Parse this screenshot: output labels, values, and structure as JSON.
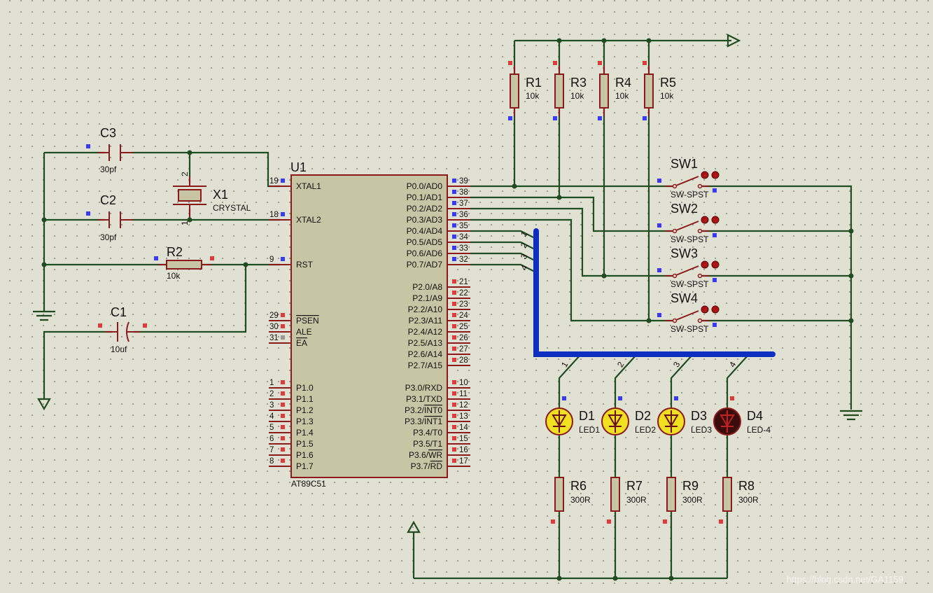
{
  "colors": {
    "background": "#e1e1d3",
    "wire": "#1f4d1f",
    "component": "#8b1a1a",
    "chip_fill": "#c8c5a4",
    "bus": "#0d2fbf",
    "led_on": "#f0e020",
    "led_off": "#3a0c0c",
    "pin_high": "#e23b3b",
    "pin_low": "#3b3bff"
  },
  "mcu": {
    "ref": "U1",
    "part": "AT89C51",
    "left_pins": [
      {
        "num": "19",
        "name": "XTAL1"
      },
      {
        "num": "18",
        "name": "XTAL2"
      },
      {
        "num": "9",
        "name": "RST"
      },
      {
        "num": "29",
        "name": "PSEN"
      },
      {
        "num": "30",
        "name": "ALE"
      },
      {
        "num": "31",
        "name": "EA"
      },
      {
        "num": "1",
        "name": "P1.0"
      },
      {
        "num": "2",
        "name": "P1.1"
      },
      {
        "num": "3",
        "name": "P1.2"
      },
      {
        "num": "4",
        "name": "P1.3"
      },
      {
        "num": "5",
        "name": "P1.4"
      },
      {
        "num": "6",
        "name": "P1.5"
      },
      {
        "num": "7",
        "name": "P1.6"
      },
      {
        "num": "8",
        "name": "P1.7"
      }
    ],
    "right_pins": [
      {
        "num": "39",
        "name": "P0.0/AD0"
      },
      {
        "num": "38",
        "name": "P0.1/AD1"
      },
      {
        "num": "37",
        "name": "P0.2/AD2"
      },
      {
        "num": "36",
        "name": "P0.3/AD3"
      },
      {
        "num": "35",
        "name": "P0.4/AD4"
      },
      {
        "num": "34",
        "name": "P0.5/AD5"
      },
      {
        "num": "33",
        "name": "P0.6/AD6"
      },
      {
        "num": "32",
        "name": "P0.7/AD7"
      },
      {
        "num": "21",
        "name": "P2.0/A8"
      },
      {
        "num": "22",
        "name": "P2.1/A9"
      },
      {
        "num": "23",
        "name": "P2.2/A10"
      },
      {
        "num": "24",
        "name": "P2.3/A11"
      },
      {
        "num": "25",
        "name": "P2.4/A12"
      },
      {
        "num": "26",
        "name": "P2.5/A13"
      },
      {
        "num": "27",
        "name": "P2.6/A14"
      },
      {
        "num": "28",
        "name": "P2.7/A15"
      },
      {
        "num": "10",
        "name": "P3.0/RXD"
      },
      {
        "num": "11",
        "name": "P3.1/TXD"
      },
      {
        "num": "12",
        "name": "P3.2/INT0"
      },
      {
        "num": "13",
        "name": "P3.3/INT1"
      },
      {
        "num": "14",
        "name": "P3.4/T0"
      },
      {
        "num": "15",
        "name": "P3.5/T1"
      },
      {
        "num": "16",
        "name": "P3.6/WR"
      },
      {
        "num": "17",
        "name": "P3.7/RD"
      }
    ]
  },
  "caps": [
    {
      "ref": "C3",
      "value": "30pf"
    },
    {
      "ref": "C2",
      "value": "30pf"
    },
    {
      "ref": "C1",
      "value": "10uf"
    }
  ],
  "crystal": {
    "ref": "X1",
    "value": "CRYSTAL",
    "pin_top": "2",
    "pin_bottom": "1"
  },
  "reset_resistor": {
    "ref": "R2",
    "value": "10k"
  },
  "pullups": [
    {
      "ref": "R1",
      "value": "10k"
    },
    {
      "ref": "R3",
      "value": "10k"
    },
    {
      "ref": "R4",
      "value": "10k"
    },
    {
      "ref": "R5",
      "value": "10k"
    }
  ],
  "switches": [
    {
      "ref": "SW1",
      "value": "SW-SPST"
    },
    {
      "ref": "SW2",
      "value": "SW-SPST"
    },
    {
      "ref": "SW3",
      "value": "SW-SPST"
    },
    {
      "ref": "SW4",
      "value": "SW-SPST"
    }
  ],
  "leds": [
    {
      "ref": "D1",
      "value": "LED1",
      "on": true
    },
    {
      "ref": "D2",
      "value": "LED2",
      "on": true
    },
    {
      "ref": "D3",
      "value": "LED3",
      "on": true
    },
    {
      "ref": "D4",
      "value": "LED-4",
      "on": false
    }
  ],
  "led_resistors": [
    {
      "ref": "R6",
      "value": "300R"
    },
    {
      "ref": "R7",
      "value": "300R"
    },
    {
      "ref": "R9",
      "value": "300R"
    },
    {
      "ref": "R8",
      "value": "300R"
    }
  ],
  "bus_labels": {
    "entries_top": [
      "1",
      "2",
      "3",
      "4"
    ],
    "entries_bottom": [
      "1",
      "2",
      "3",
      "4"
    ]
  },
  "watermark": "https://blog.csdn.net/GA1159"
}
